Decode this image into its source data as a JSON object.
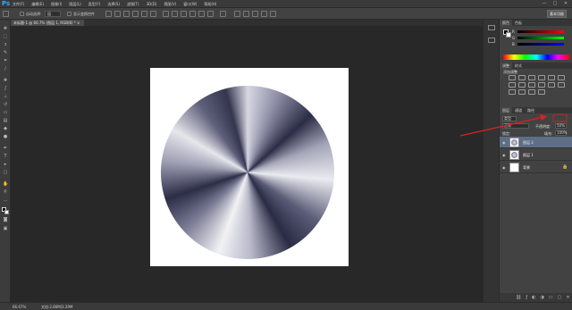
{
  "app": {
    "logo": "Ps"
  },
  "menu": {
    "items": [
      "文件(F)",
      "编辑(E)",
      "图像(I)",
      "图层(L)",
      "类型(Y)",
      "选择(S)",
      "滤镜(T)",
      "3D(D)",
      "视图(V)",
      "窗口(W)",
      "帮助(H)"
    ]
  },
  "window_controls": {
    "minimize": "—",
    "maximize": "□",
    "close": "✕"
  },
  "options_bar": {
    "auto_select_label": "自动选择:",
    "auto_select_value": "组",
    "transform_label": "显示变换控件",
    "workspace_button": "基本功能"
  },
  "document": {
    "tab_label": "未标题-1 @ 66.7% (图层 1, RGB/8) * ✕",
    "zoom": "66.67%",
    "status_info": "文档:2.86M/3.29M"
  },
  "panels": {
    "color_tabs": [
      "颜色",
      "色板"
    ],
    "color_sliders": [
      "R",
      "G",
      "B"
    ],
    "adjust_tabs": [
      "调整",
      "样式"
    ],
    "adjust_title": "添加调整",
    "layers_tabs": [
      "图层",
      "通道",
      "路径"
    ],
    "filter_kind": "类型",
    "blend_mode": "正常",
    "opacity_label": "不透明度:",
    "opacity_value": "50%",
    "lock_label": "锁定:",
    "fill_label": "填充:",
    "fill_value": "100%",
    "layers": [
      {
        "name": "图层 2",
        "selected": true
      },
      {
        "name": "图层 1",
        "selected": false
      },
      {
        "name": "背景",
        "selected": false
      }
    ],
    "footer_icons": [
      "link-icon",
      "fx-icon",
      "mask-icon",
      "adjustment-icon",
      "folder-icon",
      "new-layer-icon",
      "trash-icon"
    ]
  },
  "colors": {
    "accent_ps": "#31a8ff",
    "annotation_arrow": "#e02020",
    "selected_layer": "#5d6e86"
  }
}
